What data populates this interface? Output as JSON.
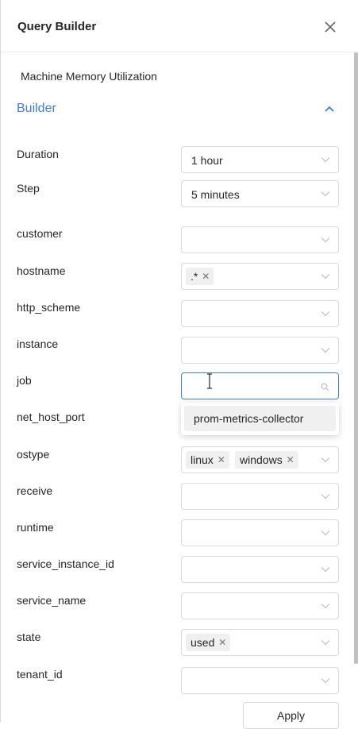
{
  "header": {
    "title": "Query Builder"
  },
  "query_name": "Machine Memory Utilization",
  "builder": {
    "title": "Builder"
  },
  "fields": [
    {
      "label": "Duration",
      "value": "1 hour"
    },
    {
      "label": "Step",
      "value": "5 minutes"
    },
    {
      "label": "customer",
      "value": ""
    },
    {
      "label": "hostname",
      "tags": [
        ".*"
      ]
    },
    {
      "label": "http_scheme",
      "value": ""
    },
    {
      "label": "instance",
      "value": ""
    },
    {
      "label": "job",
      "value": ""
    },
    {
      "label": "net_host_port",
      "value": ""
    },
    {
      "label": "ostype",
      "tags": [
        "linux",
        "windows"
      ]
    },
    {
      "label": "receive",
      "value": ""
    },
    {
      "label": "runtime",
      "value": ""
    },
    {
      "label": "service_instance_id",
      "value": ""
    },
    {
      "label": "service_name",
      "value": ""
    },
    {
      "label": "state",
      "tags": [
        "used"
      ]
    },
    {
      "label": "tenant_id",
      "value": ""
    }
  ],
  "job_dropdown": {
    "options": [
      "prom-metrics-collector"
    ]
  },
  "apply_label": "Apply",
  "colors": {
    "accent": "#3e7fd6",
    "border": "#d9d9d9",
    "tag_bg": "#f0f0f0"
  },
  "icons": {
    "close": "close-icon",
    "collapse": "chevron-up-icon",
    "select": "chevron-down-icon",
    "search": "search-icon",
    "remove": "remove-tag-icon"
  }
}
